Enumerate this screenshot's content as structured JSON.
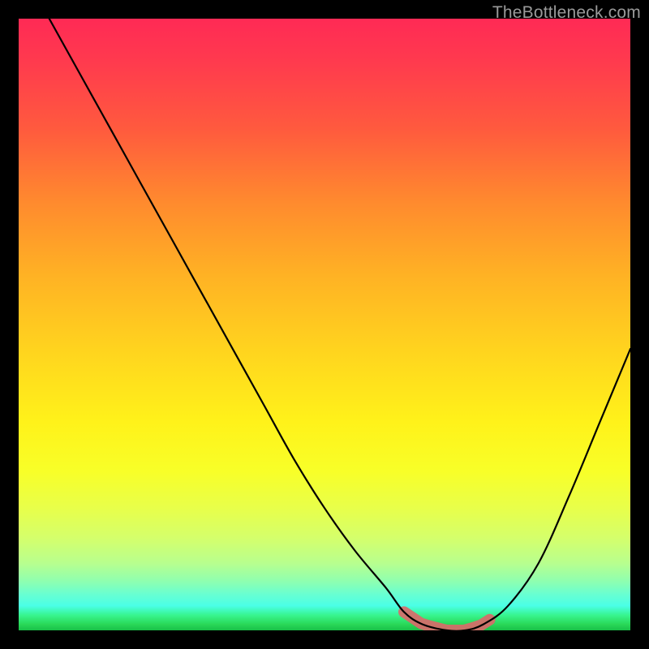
{
  "watermark": "TheBottleneck.com",
  "colors": {
    "page_bg": "#000000",
    "curve": "#000000",
    "highlight": "#d86a6a",
    "watermark_text": "#9a9a9a"
  },
  "chart_data": {
    "type": "line",
    "title": "",
    "xlabel": "",
    "ylabel": "",
    "xlim": [
      0,
      100
    ],
    "ylim": [
      0,
      100
    ],
    "grid": false,
    "legend": false,
    "series": [
      {
        "name": "bottleneck-curve",
        "x": [
          5,
          10,
          15,
          20,
          25,
          30,
          35,
          40,
          45,
          50,
          55,
          60,
          63,
          66,
          70,
          73,
          76,
          80,
          85,
          90,
          95,
          100
        ],
        "values": [
          100,
          91,
          82,
          73,
          64,
          55,
          46,
          37,
          28,
          20,
          13,
          7,
          3,
          1,
          0,
          0,
          1,
          4,
          11,
          22,
          34,
          46
        ]
      }
    ],
    "highlight_range": {
      "x": [
        63,
        77
      ],
      "note": "flat minimum, drawn as thick salmon segment"
    }
  }
}
